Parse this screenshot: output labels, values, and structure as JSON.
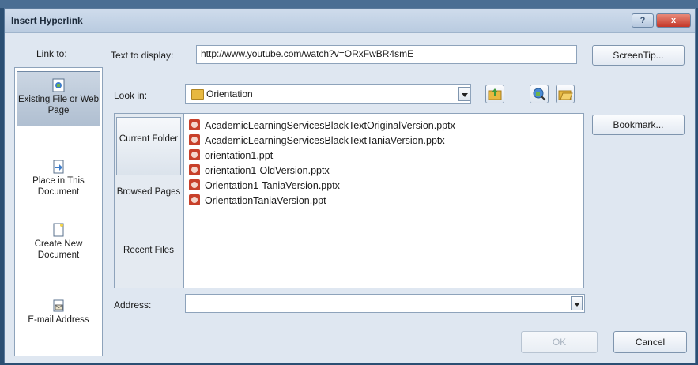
{
  "window": {
    "title": "Insert Hyperlink",
    "help_label": "?",
    "close_label": "x"
  },
  "link_to": {
    "label": "Link to:",
    "items": [
      {
        "label": "Existing File or Web Page",
        "icon": "web-page-icon",
        "active": true
      },
      {
        "label": "Place in This Document",
        "icon": "document-place-icon",
        "active": false
      },
      {
        "label": "Create New Document",
        "icon": "new-document-icon",
        "active": false
      },
      {
        "label": "E-mail Address",
        "icon": "email-icon",
        "active": false
      }
    ]
  },
  "text_to_display": {
    "label": "Text to display:",
    "value": "http://www.youtube.com/watch?v=ORxFwBR4smE"
  },
  "screentip_label": "ScreenTip...",
  "look_in": {
    "label": "Look in:",
    "value": "Orientation"
  },
  "bookmark_label": "Bookmark...",
  "nav": {
    "items": [
      {
        "label": "Current Folder",
        "active": true
      },
      {
        "label": "Browsed Pages",
        "active": false
      },
      {
        "label": "Recent Files",
        "active": false
      }
    ]
  },
  "files": [
    "AcademicLearningServicesBlackTextOriginalVersion.pptx",
    "AcademicLearningServicesBlackTextTaniaVersion.pptx",
    "orientation1.ppt",
    "orientation1-OldVersion.pptx",
    "Orientation1-TaniaVersion.pptx",
    "OrientationTaniaVersion.ppt"
  ],
  "address": {
    "label": "Address:",
    "value": ""
  },
  "buttons": {
    "ok": "OK",
    "cancel": "Cancel"
  },
  "colors": {
    "title_bar": "#c3d3e6",
    "close_button": "#c4382a",
    "ppt_icon": "#c8402a",
    "folder": "#e7b840"
  }
}
